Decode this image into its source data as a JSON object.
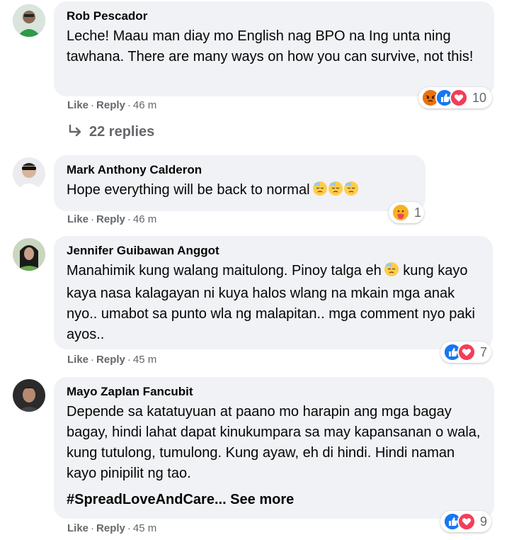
{
  "comments": [
    {
      "author": "Rob Pescador",
      "text": "Leche! Maau man diay mo English nag BPO na Ing unta ning tawhana. There are many ways on how you can survive, not this!",
      "like_label": "Like",
      "reply_label": "Reply",
      "time": "46 m",
      "reaction_count": "10",
      "reactions": [
        "angry-icon",
        "like-icon",
        "love-icon"
      ]
    },
    {
      "author": "Mark Anthony Calderon",
      "text": "Hope everything will be back to normal",
      "like_label": "Like",
      "reply_label": "Reply",
      "time": "46 m",
      "reaction_count": "1",
      "reactions": [
        "care-icon"
      ]
    },
    {
      "author": "Jennifer Guibawan Anggot",
      "text": "Manahimik kung walang maitulong. Pinoy talga eh",
      "text2": "kung kayo kaya nasa kalagayan ni kuya halos wlang na mkain mga anak nyo.. umabot sa punto wla ng malapitan.. mga comment nyo paki ayos..",
      "like_label": "Like",
      "reply_label": "Reply",
      "time": "45 m",
      "reaction_count": "7",
      "reactions": [
        "like-icon",
        "love-icon"
      ]
    },
    {
      "author": "Mayo Zaplan Fancubit",
      "text": "Depende sa katatuyuan at paano mo harapin ang mga bagay bagay, hindi lahat dapat kinukumpara sa may kapansanan o wala, kung tutulong, tumulong. Kung ayaw, eh di hindi. Hindi naman kayo pinipilit ng tao.",
      "hashtag": "#SpreadLoveAndCare... See more",
      "like_label": "Like",
      "reply_label": "Reply",
      "time": "45 m",
      "reaction_count": "9",
      "reactions": [
        "like-icon",
        "love-icon"
      ]
    }
  ],
  "replies_label": "22 replies",
  "colors": {
    "bubble": "#f0f2f5",
    "meta": "#65676b",
    "like": "#1877f2",
    "love": "#f33e58",
    "angry": "#e9710f"
  }
}
